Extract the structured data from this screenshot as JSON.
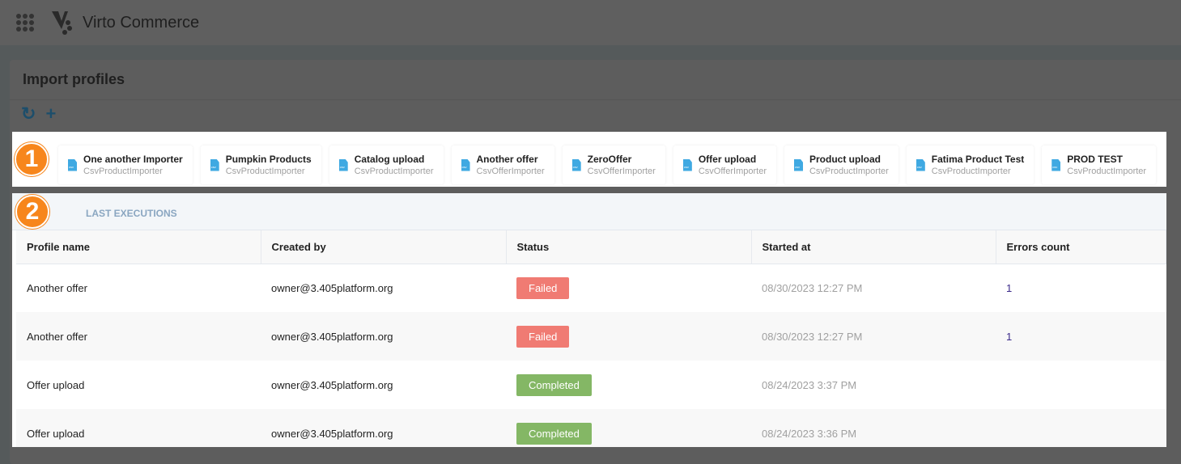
{
  "app": {
    "title": "Virto Commerce"
  },
  "page": {
    "title": "Import profiles"
  },
  "toolbar": {
    "refresh_icon": "refresh-icon",
    "add_icon": "plus-icon"
  },
  "callouts": [
    "1",
    "2"
  ],
  "profiles": [
    {
      "name": "One another Importer",
      "type": "CsvProductImporter"
    },
    {
      "name": "Pumpkin Products",
      "type": "CsvProductImporter"
    },
    {
      "name": "Catalog upload",
      "type": "CsvProductImporter"
    },
    {
      "name": "Another offer",
      "type": "CsvOfferImporter"
    },
    {
      "name": "ZeroOffer",
      "type": "CsvOfferImporter"
    },
    {
      "name": "Offer upload",
      "type": "CsvOfferImporter"
    },
    {
      "name": "Product upload",
      "type": "CsvProductImporter"
    },
    {
      "name": "Fatima Product Test",
      "type": "CsvProductImporter"
    },
    {
      "name": "PROD TEST",
      "type": "CsvProductImporter"
    }
  ],
  "executions": {
    "title": "LAST EXECUTIONS",
    "columns": [
      "Profile name",
      "Created by",
      "Status",
      "Started at",
      "Errors count"
    ],
    "rows": [
      {
        "profile": "Another offer",
        "created_by": "owner@3.405platform.org",
        "status": "Failed",
        "started": "08/30/2023 12:27 PM",
        "errors": "1"
      },
      {
        "profile": "Another offer",
        "created_by": "owner@3.405platform.org",
        "status": "Failed",
        "started": "08/30/2023 12:27 PM",
        "errors": "1"
      },
      {
        "profile": "Offer upload",
        "created_by": "owner@3.405platform.org",
        "status": "Completed",
        "started": "08/24/2023 3:37 PM",
        "errors": ""
      },
      {
        "profile": "Offer upload",
        "created_by": "owner@3.405platform.org",
        "status": "Completed",
        "started": "08/24/2023 3:36 PM",
        "errors": ""
      }
    ]
  },
  "colors": {
    "failed": "#f07b73",
    "completed": "#84b765",
    "callout": "#f7861c"
  }
}
